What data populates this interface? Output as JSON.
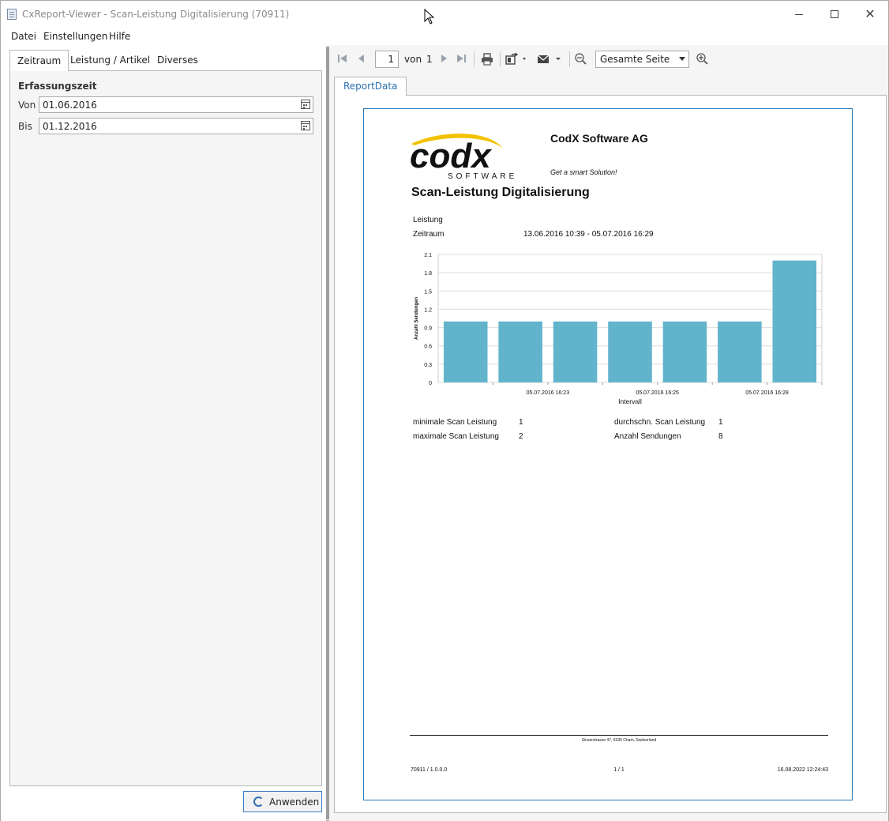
{
  "window": {
    "title": "CxReport-Viewer - Scan-Leistung Digitalisierung (70911)"
  },
  "menu": {
    "items": [
      {
        "label": "Datei"
      },
      {
        "label": "Einstellungen"
      },
      {
        "label": "Hilfe"
      }
    ]
  },
  "left": {
    "tabs": [
      {
        "label": "Zeitraum",
        "active": true
      },
      {
        "label": "Leistung / Artikel",
        "active": false
      },
      {
        "label": "Diverses",
        "active": false
      }
    ],
    "section_title": "Erfassungszeit",
    "from_label": "Von",
    "from_value": "01.06.2016",
    "to_label": "Bis",
    "to_value": "01.12.2016",
    "apply_label": "Anwenden"
  },
  "toolbar": {
    "page_current": "1",
    "page_of": "von",
    "page_total": "1",
    "zoom_value": "Gesamte Seite"
  },
  "doc_tab": "ReportData",
  "report": {
    "company": "CodX Software AG",
    "slogan": "Get a smart Solution!",
    "title": "Scan-Leistung Digitalisierung",
    "leistung_label": "Leistung",
    "zeitraum_label": "Zeitraum",
    "zeitraum_value": "13.06.2016 10:39 - 05.07.2016 16:29",
    "stats": {
      "min_label": "minimale Scan Leistung",
      "min_value": "1",
      "max_label": "maximale Scan Leistung",
      "max_value": "2",
      "avg_label": "durchschn. Scan Leistung",
      "avg_value": "1",
      "count_label": "Anzahl Sendungen",
      "count_value": "8"
    },
    "footer": {
      "address": "Sinserstrasse 47, 6330 Cham, Switzerland",
      "version": "70911 / 1.0.0.0",
      "page": "1 / 1",
      "timestamp": "16.08.2022 12:24:43"
    }
  },
  "chart_data": {
    "type": "bar",
    "xlabel": "Intervall",
    "ylabel": "Anzahl Sendungen",
    "ylim": [
      0,
      2.1
    ],
    "yticks": [
      "0",
      "0.3",
      "0.6",
      "0.9",
      "1.2",
      "1.5",
      "1.8",
      "2.1"
    ],
    "categories": [
      "",
      "05.07.2016 16:23",
      "",
      "05.07.2016 16:25",
      "",
      "05.07.2016 16:28",
      ""
    ],
    "values": [
      1,
      1,
      1,
      1,
      1,
      1,
      2
    ],
    "bar_color": "#62b4cc",
    "grid": true
  },
  "logo": {
    "text": "codx",
    "subtext": "SOFTWARE",
    "swoosh_color": "#f2c200"
  }
}
